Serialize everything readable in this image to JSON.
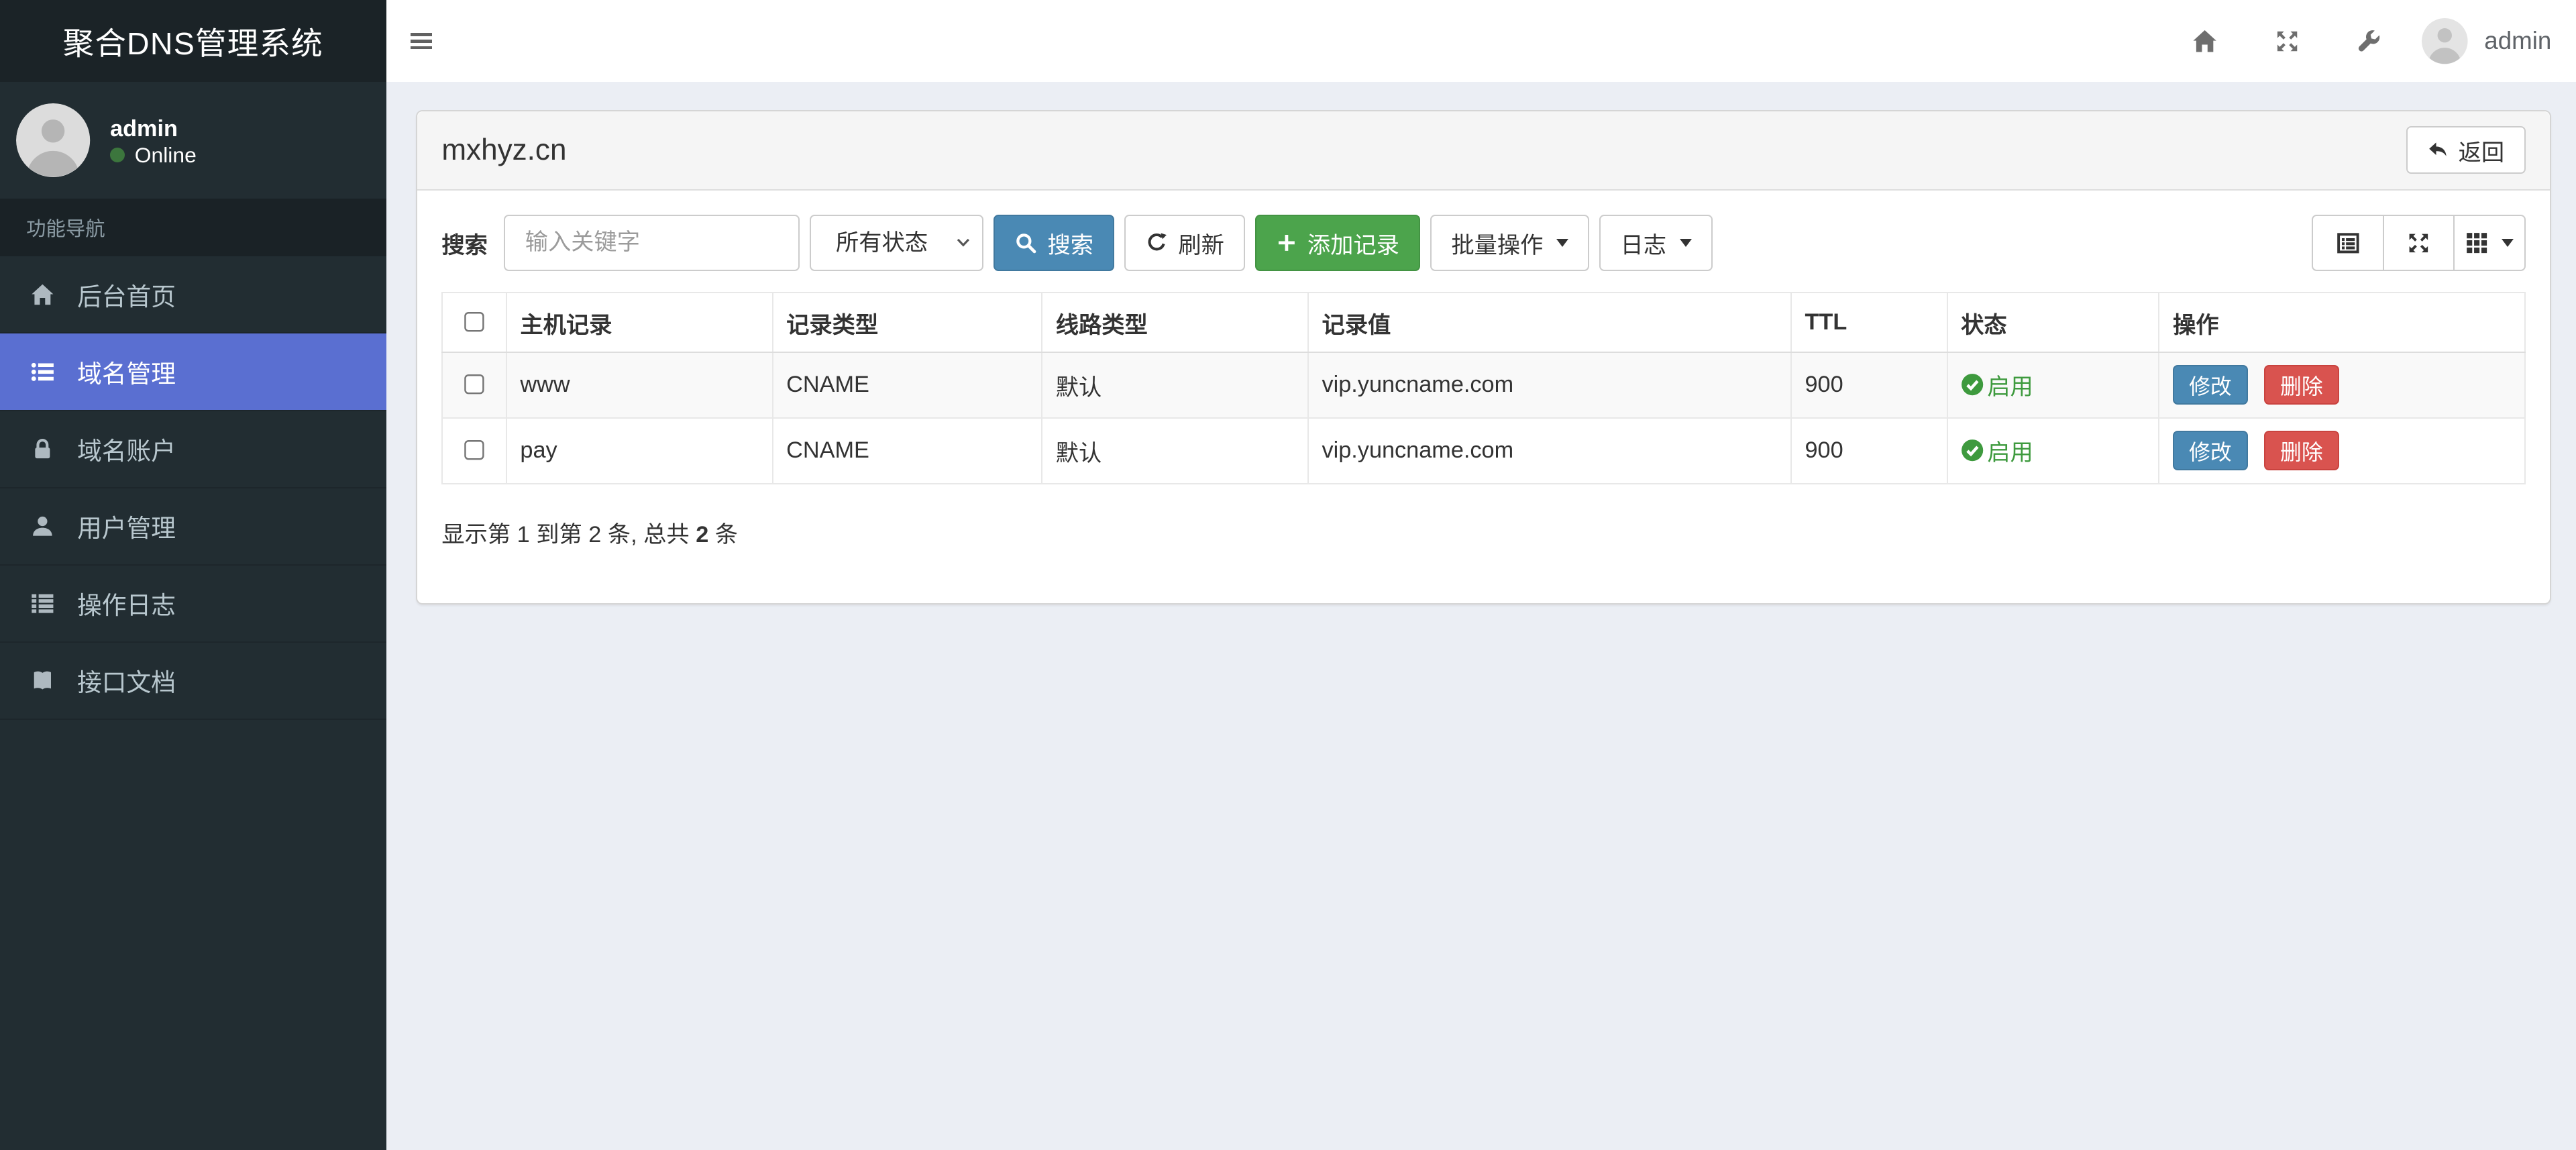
{
  "app": {
    "title": "聚合DNS管理系统"
  },
  "navbar": {
    "icons": [
      "home-icon",
      "expand-icon",
      "wrench-icon"
    ],
    "user": "admin"
  },
  "sidebar": {
    "user": {
      "name": "admin",
      "status": "Online"
    },
    "section_label": "功能导航",
    "items": [
      {
        "label": "后台首页",
        "icon": "home-icon",
        "active": false
      },
      {
        "label": "域名管理",
        "icon": "th-list-icon",
        "active": true
      },
      {
        "label": "域名账户",
        "icon": "lock-icon",
        "active": false
      },
      {
        "label": "用户管理",
        "icon": "user-icon",
        "active": false
      },
      {
        "label": "操作日志",
        "icon": "list-icon",
        "active": false
      },
      {
        "label": "接口文档",
        "icon": "book-icon",
        "active": false
      }
    ]
  },
  "page": {
    "title": "mxhyz.cn",
    "back_label": "返回"
  },
  "toolbar": {
    "search_label": "搜索",
    "search_placeholder": "输入关键字",
    "search_value": "",
    "status_filter_selected": "所有状态",
    "search_button": "搜索",
    "refresh_button": "刷新",
    "add_button": "添加记录",
    "batch_button": "批量操作",
    "log_button": "日志",
    "view_buttons": [
      "card-view-icon",
      "fullscreen-icon",
      "columns-grid-icon"
    ]
  },
  "table": {
    "columns": [
      "主机记录",
      "记录类型",
      "线路类型",
      "记录值",
      "TTL",
      "状态",
      "操作"
    ],
    "rows": [
      {
        "host": "www",
        "type": "CNAME",
        "line": "默认",
        "value": "vip.yuncname.com",
        "ttl": "900",
        "status": "启用",
        "edit": "修改",
        "delete": "删除"
      },
      {
        "host": "pay",
        "type": "CNAME",
        "line": "默认",
        "value": "vip.yuncname.com",
        "ttl": "900",
        "status": "启用",
        "edit": "修改",
        "delete": "删除"
      }
    ],
    "summary": {
      "prefix": "显示第 1 到第 2 条, 总共 ",
      "total": "2",
      "suffix": " 条"
    }
  },
  "colors": {
    "sidebar_bg": "#222d32",
    "active_menu": "#5a6fd1",
    "primary": "#4a89b4",
    "success": "#4ca44c",
    "danger": "#d9534f",
    "status_green": "#3e9a3e",
    "content_bg": "#ebeef4"
  }
}
